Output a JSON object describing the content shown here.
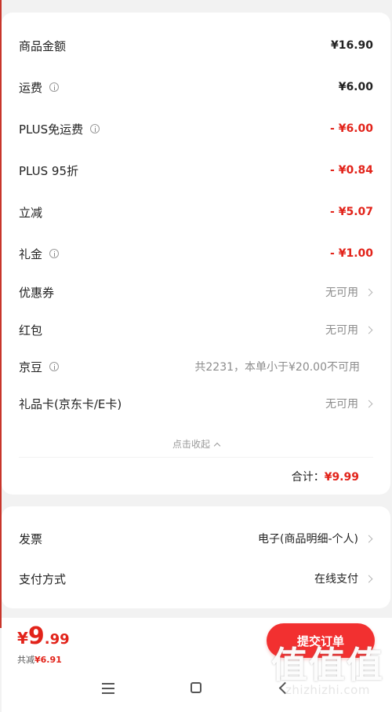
{
  "fees": [
    {
      "label": "商品金额",
      "value": "¥16.90",
      "info": false,
      "style": "dark"
    },
    {
      "label": "运费",
      "value": "¥6.00",
      "info": true,
      "style": "dark"
    },
    {
      "label": "PLUS免运费",
      "value": "- ¥6.00",
      "info": true,
      "style": "red"
    },
    {
      "label": "PLUS 95折",
      "value": "- ¥0.84",
      "info": false,
      "style": "red"
    },
    {
      "label": "立减",
      "value": "- ¥5.07",
      "info": false,
      "style": "red"
    },
    {
      "label": "礼金",
      "value": "- ¥1.00",
      "info": true,
      "style": "red"
    },
    {
      "label": "优惠券",
      "value": "无可用",
      "info": false,
      "style": "gray",
      "chevron": true
    },
    {
      "label": "红包",
      "value": "无可用",
      "info": false,
      "style": "gray",
      "chevron": true
    },
    {
      "label": "京豆",
      "value": "共2231，本单小于¥20.00不可用",
      "info": true,
      "style": "gray"
    },
    {
      "label": "礼品卡(京东卡/E卡)",
      "value": "无可用",
      "info": false,
      "style": "gray",
      "chevron": true
    }
  ],
  "collapse_label": "点击收起",
  "total": {
    "label": "合计：",
    "amount": "¥9.99"
  },
  "meta": [
    {
      "label": "发票",
      "value": "电子(商品明细-个人)"
    },
    {
      "label": "支付方式",
      "value": "在线支付"
    }
  ],
  "bottom": {
    "price_yen": "¥",
    "price_int": "9",
    "price_dec": ".99",
    "saved_label": "共减",
    "saved_amount": "¥6.91",
    "submit_label": "提交订单"
  },
  "watermark": {
    "big": "值值值",
    "small": "zhizhizhi.com"
  },
  "colors": {
    "accent": "#e2231a",
    "button": "#f23030"
  },
  "icons": [
    "info-icon",
    "chevron-right-icon",
    "chevron-up-icon",
    "menu-icon",
    "home-icon",
    "back-icon"
  ]
}
